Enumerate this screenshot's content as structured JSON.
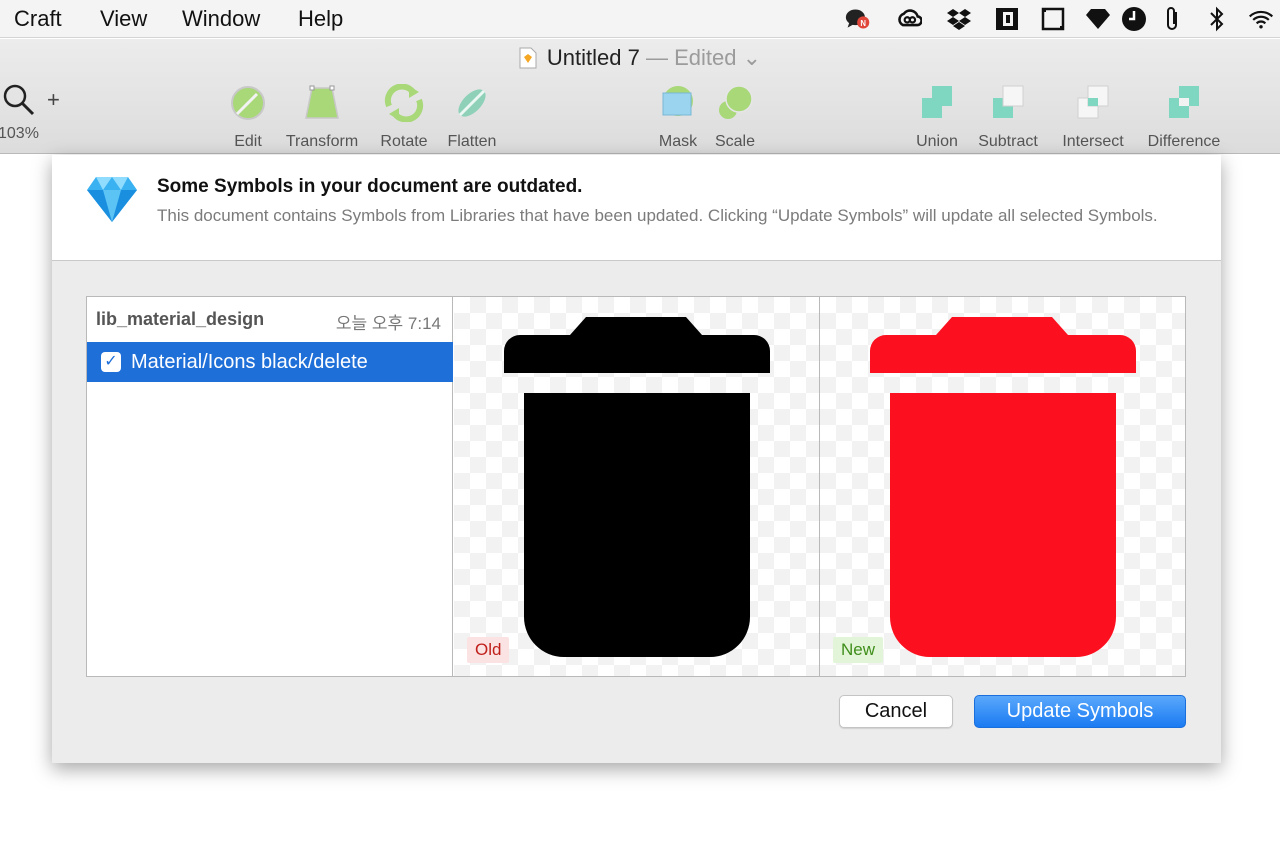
{
  "menubar": {
    "items": [
      "Craft",
      "View",
      "Window",
      "Help"
    ],
    "tray_icons": [
      "chat-notification-icon",
      "creative-cloud-icon",
      "dropbox-icon",
      "screen-app-icon",
      "window-frame-icon",
      "vpn-diamond-icon",
      "clock-icon",
      "attachment-icon",
      "bluetooth-icon",
      "wifi-icon"
    ],
    "notification_badge": "N"
  },
  "window": {
    "title": "Untitled 7",
    "status": "— Edited"
  },
  "toolbar": {
    "zoom": "103%",
    "zoom_plus": "+",
    "tools": [
      {
        "label": "Edit",
        "icon": "edit-icon"
      },
      {
        "label": "Transform",
        "icon": "transform-icon"
      },
      {
        "label": "Rotate",
        "icon": "rotate-icon"
      },
      {
        "label": "Flatten",
        "icon": "flatten-icon"
      },
      {
        "label": "Mask",
        "icon": "mask-icon"
      },
      {
        "label": "Scale",
        "icon": "scale-icon"
      },
      {
        "label": "Union",
        "icon": "union-icon"
      },
      {
        "label": "Subtract",
        "icon": "subtract-icon"
      },
      {
        "label": "Intersect",
        "icon": "intersect-icon"
      },
      {
        "label": "Difference",
        "icon": "difference-icon"
      }
    ]
  },
  "dialog": {
    "title": "Some Symbols in your document are outdated.",
    "description": "This document contains Symbols from Libraries that have been updated. Clicking “Update Symbols” will update all selected Symbols.",
    "library": {
      "name": "lib_material_design",
      "updated": "오늘 오후 7:14"
    },
    "symbols": [
      {
        "label": "Material/Icons black/delete",
        "checked": true
      }
    ],
    "preview": {
      "old_tag": "Old",
      "new_tag": "New",
      "old_color": "#000000",
      "new_color": "#fc0f1e"
    },
    "buttons": {
      "cancel": "Cancel",
      "update": "Update Symbols"
    },
    "accent_color": "#1f6fd8"
  }
}
